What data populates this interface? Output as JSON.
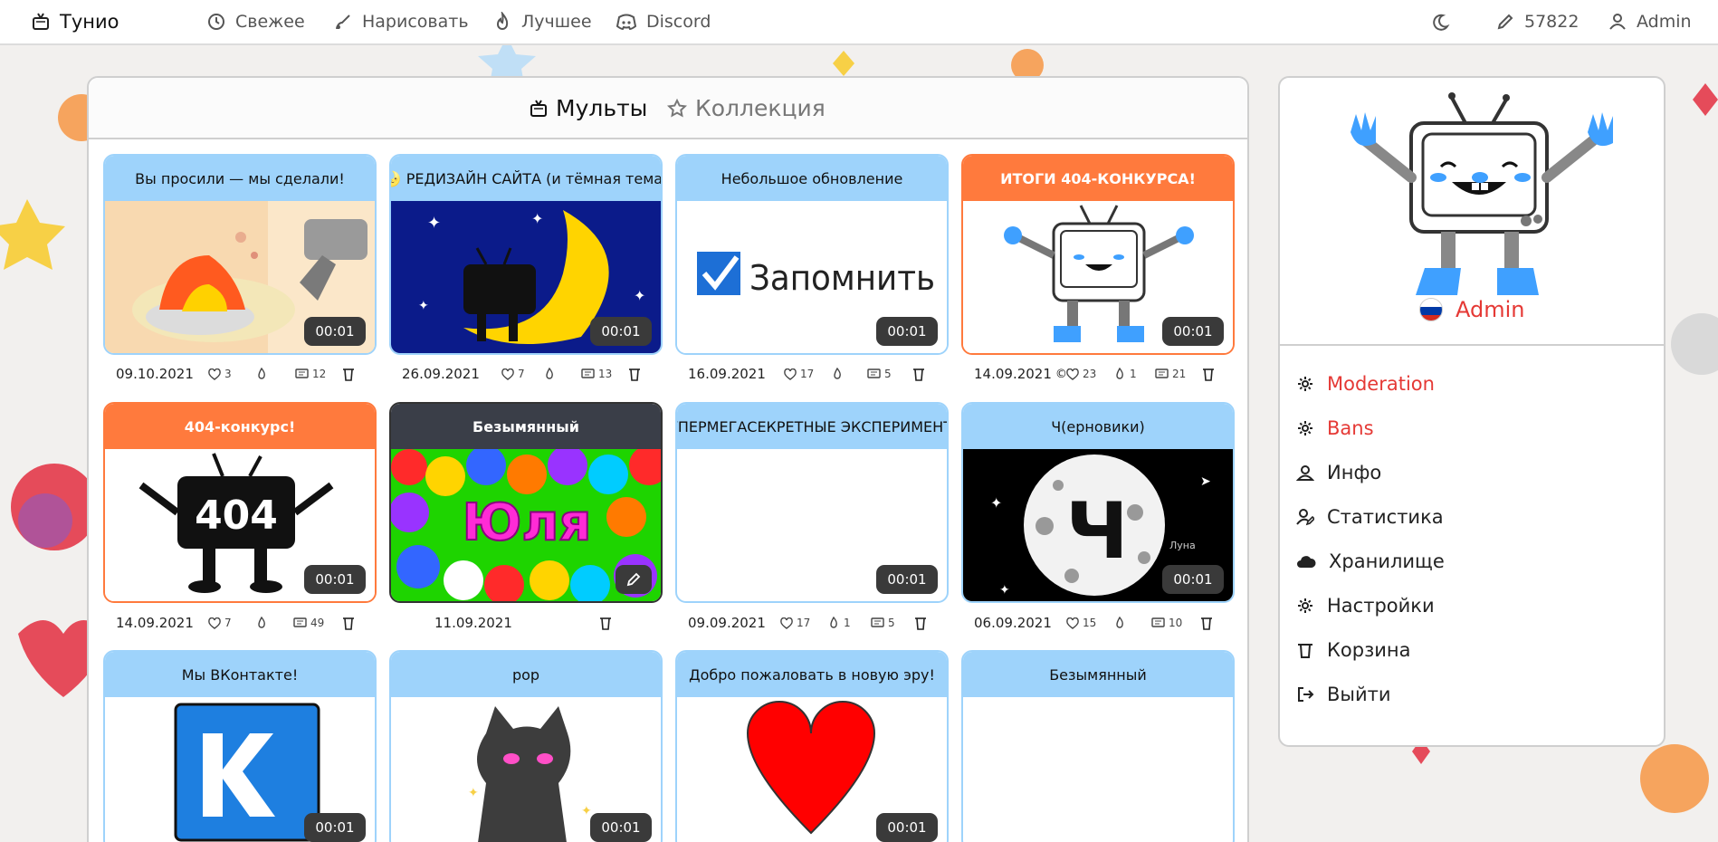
{
  "topbar": {
    "brand": "Тунио",
    "nav": [
      "Свежее",
      "Нарисовать",
      "Лучшее",
      "Discord"
    ],
    "points": "57822",
    "user": "Admin"
  },
  "tabs": {
    "active": "Мульты",
    "inactive": "Коллекция"
  },
  "cards": [
    {
      "title": "Вы просили — мы сделали!",
      "style": "blue",
      "duration": "00:01",
      "date": "09.10.2021",
      "likes": "3",
      "reposts": "",
      "comments": "12",
      "thumb": "fire"
    },
    {
      "title": "🌛 РЕДИЗАЙН САЙТА (и тёмная тема)",
      "style": "blue",
      "duration": "00:01",
      "date": "26.09.2021",
      "likes": "7",
      "reposts": "",
      "comments": "13",
      "thumb": "moon"
    },
    {
      "title": "Небольшое обновление",
      "style": "blue",
      "duration": "00:01",
      "date": "16.09.2021",
      "likes": "17",
      "reposts": "",
      "comments": "5",
      "thumb": "remember",
      "thumb_text": "Запомнить"
    },
    {
      "title": "ИТОГИ 404-КОНКУРСА!",
      "style": "orange",
      "duration": "00:01",
      "date": "14.09.2021",
      "date_suffix": "©",
      "likes": "23",
      "reposts": "1",
      "comments": "21",
      "thumb": "tv"
    },
    {
      "title": "404-конкурс!",
      "style": "orange",
      "duration": "00:01",
      "date": "14.09.2021",
      "likes": "7",
      "reposts": "",
      "comments": "49",
      "thumb": "e404",
      "thumb_text": "404"
    },
    {
      "title": "Безымянный",
      "style": "dark",
      "duration": "",
      "date": "11.09.2021",
      "likes": "",
      "reposts": "",
      "comments": "",
      "thumb": "hearts",
      "thumb_text": "Юля"
    },
    {
      "title": "СУПЕРМЕГАСЕКРЕТНЫЕ ЭКСПЕРИМЕНТЫ",
      "style": "blue",
      "duration": "00:01",
      "date": "09.09.2021",
      "likes": "17",
      "reposts": "1",
      "comments": "5",
      "thumb": "blank"
    },
    {
      "title": "Ч(ерновики)",
      "style": "blue",
      "duration": "00:01",
      "date": "06.09.2021",
      "likes": "15",
      "reposts": "",
      "comments": "10",
      "thumb": "ch",
      "thumb_text": "Ч",
      "thumb_note": "Луна"
    },
    {
      "title": "Мы ВКонтакте!",
      "style": "blue",
      "duration": "00:01",
      "thumb": "vk"
    },
    {
      "title": "pop",
      "style": "blue",
      "duration": "00:01",
      "thumb": "cat"
    },
    {
      "title": "Добро пожаловать в новую эру!",
      "style": "blue",
      "duration": "00:01",
      "thumb": "heart"
    },
    {
      "title": "Безымянный",
      "style": "blue",
      "duration": "",
      "thumb": "blank"
    }
  ],
  "profile": {
    "name": "Admin"
  },
  "menu": [
    {
      "label": "Moderation",
      "icon": "gear-icon",
      "red": true
    },
    {
      "label": "Bans",
      "icon": "gear-icon",
      "red": true
    },
    {
      "label": "Инфо",
      "icon": "user-icon",
      "red": false
    },
    {
      "label": "Статистика",
      "icon": "user-edit-icon",
      "red": false
    },
    {
      "label": "Хранилище",
      "icon": "cloud-icon",
      "red": false
    },
    {
      "label": "Настройки",
      "icon": "gear-icon",
      "red": false
    },
    {
      "label": "Корзина",
      "icon": "trash-icon",
      "red": false
    },
    {
      "label": "Выйти",
      "icon": "logout-icon",
      "red": false
    }
  ]
}
